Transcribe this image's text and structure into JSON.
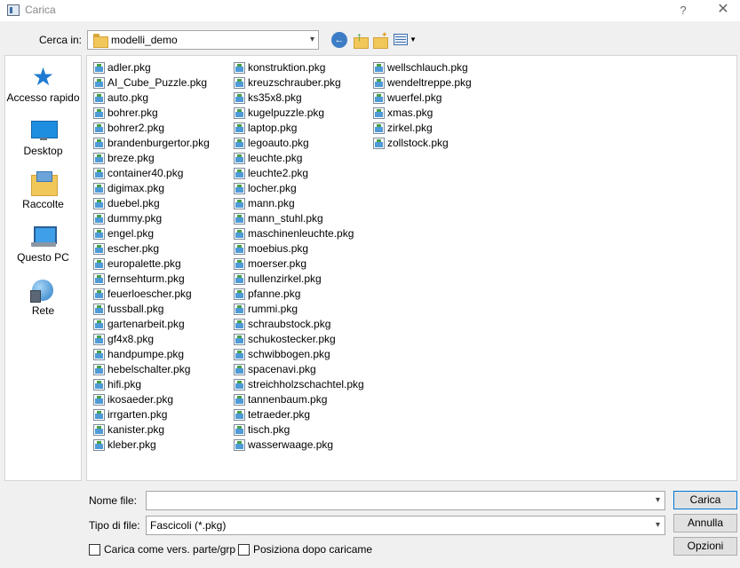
{
  "window": {
    "title": "Carica",
    "help": "?",
    "close": "✕"
  },
  "toolbar": {
    "look_in_label": "Cerca in:",
    "look_in_value": "modelli_demo",
    "icons": [
      "back-icon",
      "up-folder-icon",
      "new-folder-icon",
      "view-menu-icon"
    ]
  },
  "sidebar": {
    "items": [
      {
        "label": "Accesso rapido",
        "icon": "quick-access-star-icon"
      },
      {
        "label": "Desktop",
        "icon": "desktop-icon"
      },
      {
        "label": "Raccolte",
        "icon": "libraries-icon"
      },
      {
        "label": "Questo PC",
        "icon": "this-pc-icon"
      },
      {
        "label": "Rete",
        "icon": "network-icon"
      }
    ]
  },
  "files": {
    "columns": [
      [
        "adler.pkg",
        "AI_Cube_Puzzle.pkg",
        "auto.pkg",
        "bohrer.pkg",
        "bohrer2.pkg",
        "brandenburgertor.pkg",
        "breze.pkg",
        "container40.pkg",
        "digimax.pkg",
        "duebel.pkg",
        "dummy.pkg",
        "engel.pkg",
        "escher.pkg",
        "europalette.pkg",
        "fernsehturm.pkg",
        "feuerloescher.pkg",
        "fussball.pkg",
        "gartenarbeit.pkg",
        "gf4x8.pkg",
        "handpumpe.pkg",
        "hebelschalter.pkg",
        "hifi.pkg",
        "ikosaeder.pkg",
        "irrgarten.pkg",
        "kanister.pkg",
        "kleber.pkg"
      ],
      [
        "konstruktion.pkg",
        "kreuzschrauber.pkg",
        "ks35x8.pkg",
        "kugelpuzzle.pkg",
        "laptop.pkg",
        "legoauto.pkg",
        "leuchte.pkg",
        "leuchte2.pkg",
        "locher.pkg",
        "mann.pkg",
        "mann_stuhl.pkg",
        "maschinenleuchte.pkg",
        "moebius.pkg",
        "moerser.pkg",
        "nullenzirkel.pkg",
        "pfanne.pkg",
        "rummi.pkg",
        "schraubstock.pkg",
        "schukostecker.pkg",
        "schwibbogen.pkg",
        "spacenavi.pkg",
        "streichholzschachtel.pkg",
        "tannenbaum.pkg",
        "tetraeder.pkg",
        "tisch.pkg",
        "wasserwaage.pkg"
      ],
      [
        "wellschlauch.pkg",
        "wendeltreppe.pkg",
        "wuerfel.pkg",
        "xmas.pkg",
        "zirkel.pkg",
        "zollstock.pkg"
      ]
    ]
  },
  "footer": {
    "filename_label": "Nome file:",
    "filename_value": "",
    "filetype_label": "Tipo di file:",
    "filetype_value": "Fascicoli (*.pkg)",
    "load_button": "Carica",
    "cancel_button": "Annulla",
    "options_button": "Opzioni",
    "checkbox1_label": "Carica come vers. parte/grp",
    "checkbox1_checked": false,
    "checkbox2_label": "Posiziona dopo caricame",
    "checkbox2_checked": false
  }
}
